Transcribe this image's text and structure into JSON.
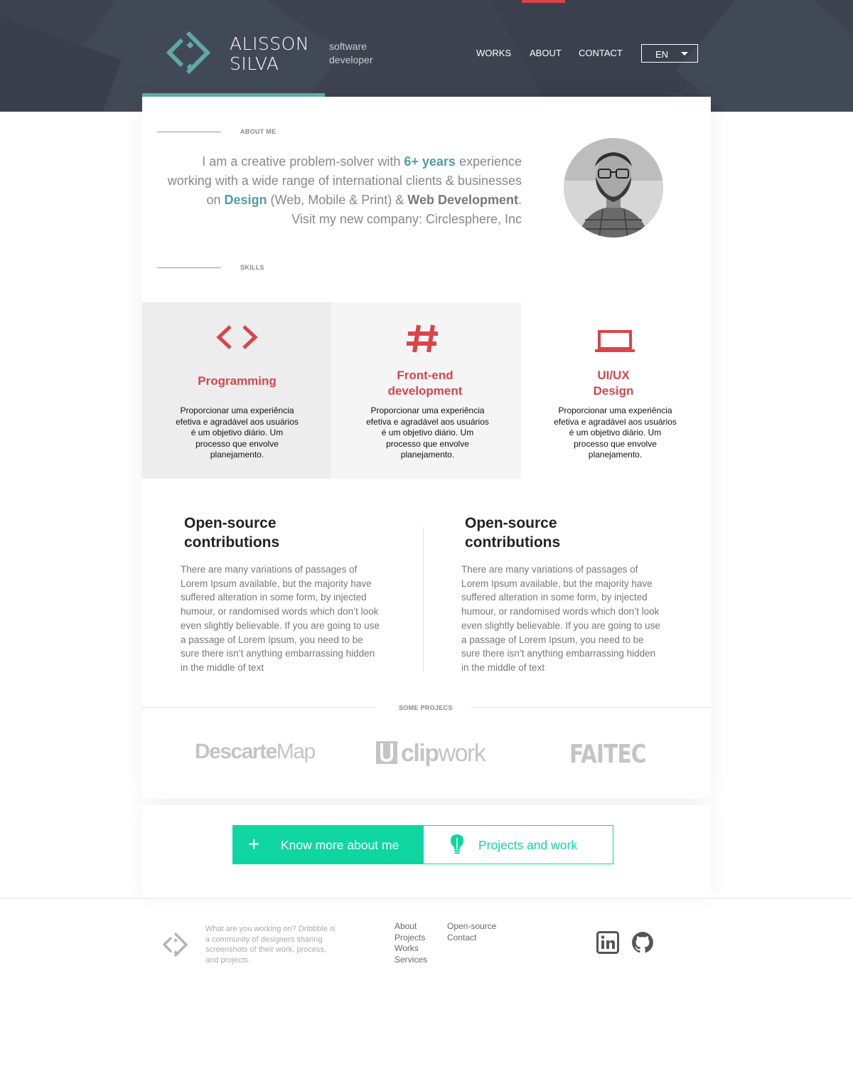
{
  "brand": {
    "first_name": "ALISSON",
    "last_name": "SILVA",
    "tagline_1": "software",
    "tagline_2": "developer",
    "accent_color": "#5fa8aa"
  },
  "nav": {
    "items": [
      "WORKS",
      "ABOUT",
      "CONTACT"
    ],
    "active": "ABOUT",
    "language": "EN"
  },
  "about": {
    "label": "ABOUT ME",
    "text_1": "I am a creative problem-solver with ",
    "highlight_years": "6+ years",
    "text_2": " experience working with a wide range of international clients & businesses on ",
    "highlight_design": "Design",
    "text_3": " (Web, Mobile & Print) & ",
    "highlight_dev": "Web Development",
    "text_4": ".",
    "text_5": "Visit my new company: Circlesphere, Inc"
  },
  "skills": {
    "label": "SKILLS",
    "items": [
      {
        "icon": "code-icon",
        "title": "Programming",
        "description": "Proporcionar uma experiência efetiva e agradável aos usuários é um objetivo diário. Um processo que envolve planejamento."
      },
      {
        "icon": "hash-icon",
        "title": "Front-end development",
        "description": "Proporcionar uma experiência efetiva e agradável aos usuários é um objetivo diário. Um processo que envolve planejamento."
      },
      {
        "icon": "laptop-icon",
        "title": "UI/UX Design",
        "description": "Proporcionar uma experiência efetiva e agradável aos usuários é um objetivo diário. Um processo que envolve planejamento."
      }
    ],
    "accent_color": "#d9434a"
  },
  "open_source": [
    {
      "title": "Open-source contributions",
      "body": "There are many variations of passages of Lorem Ipsum available, but the majority have suffered alteration in some form, by injected humour, or randomised words which don’t look even slightly believable. If you are going to use a passage of Lorem Ipsum, you need to be sure there isn’t anything embarrassing hidden in the middle of text"
    },
    {
      "title": "Open-source contributions",
      "body": "There are many variations of passages of Lorem Ipsum available, but the majority have suffered alteration in some form, by injected humour, or randomised words which don’t look even slightly believable. If you are going to use a passage of Lorem Ipsum, you need to be sure there isn’t anything embarrassing hidden in the middle of text"
    }
  ],
  "projects": {
    "label": "SOME PROJECS",
    "logos": [
      {
        "part_1": "Descarte",
        "part_2": "Map"
      },
      {
        "part_1": "clip",
        "part_2": "work"
      },
      {
        "part_1": "FAITEC",
        "part_2": ""
      }
    ]
  },
  "cta": {
    "primary": "Know more about me",
    "secondary": "Projects and work",
    "color": "#0fd6a0"
  },
  "footer": {
    "blurb": "What are you working on? Dribbble is a community of designers sharing screenshots of their work, process, and projects.",
    "links_col_1": [
      "About",
      "Projects",
      "Works",
      "Services"
    ],
    "links_col_2": [
      "Open-source",
      "Contact"
    ],
    "social": [
      "linkedin-icon",
      "github-icon"
    ]
  }
}
